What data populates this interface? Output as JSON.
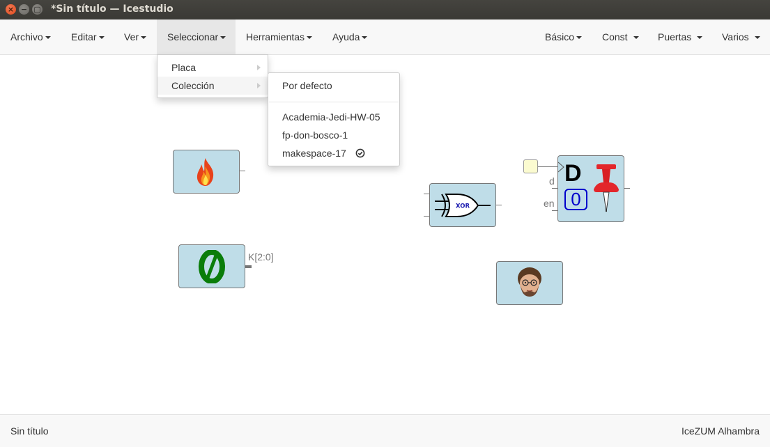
{
  "window": {
    "title": "*Sin título — Icestudio",
    "close_glyph": "×",
    "min_glyph": "−",
    "max_glyph": "▢"
  },
  "menubar": {
    "left": [
      "Archivo",
      "Editar",
      "Ver",
      "Seleccionar",
      "Herramientas",
      "Ayuda"
    ],
    "right": [
      "Básico",
      "Const",
      "Puertas",
      "Varios"
    ],
    "active": "Seleccionar"
  },
  "select_menu": {
    "items": [
      "Placa",
      "Colección"
    ],
    "hovered": "Colección"
  },
  "collection_menu": {
    "default_item": "Por defecto",
    "items": [
      "Academia-Jedi-HW-05",
      "fp-don-bosco-1",
      "makespace-17"
    ],
    "selected": "makespace-17",
    "selected_icon": "check-circle-icon"
  },
  "canvas": {
    "blocks": [
      {
        "name": "fire-block",
        "icon": "fire-icon"
      },
      {
        "name": "constant-zero-block",
        "icon": "zero-icon",
        "output_label": "K[2:0]"
      },
      {
        "name": "xor-gate-block",
        "icon": "xor-gate-icon",
        "gate_label": "XOR"
      },
      {
        "name": "dff-register-block",
        "icon": "pushpin-icon",
        "letter": "D",
        "value": "0",
        "inputs": [
          "d",
          "en"
        ]
      },
      {
        "name": "avatar-block",
        "icon": "avatar-icon"
      }
    ],
    "block_color": "#bfdde8",
    "port_color": "#777777"
  },
  "statusbar": {
    "left": "Sin título",
    "right": "IceZUM Alhambra"
  }
}
